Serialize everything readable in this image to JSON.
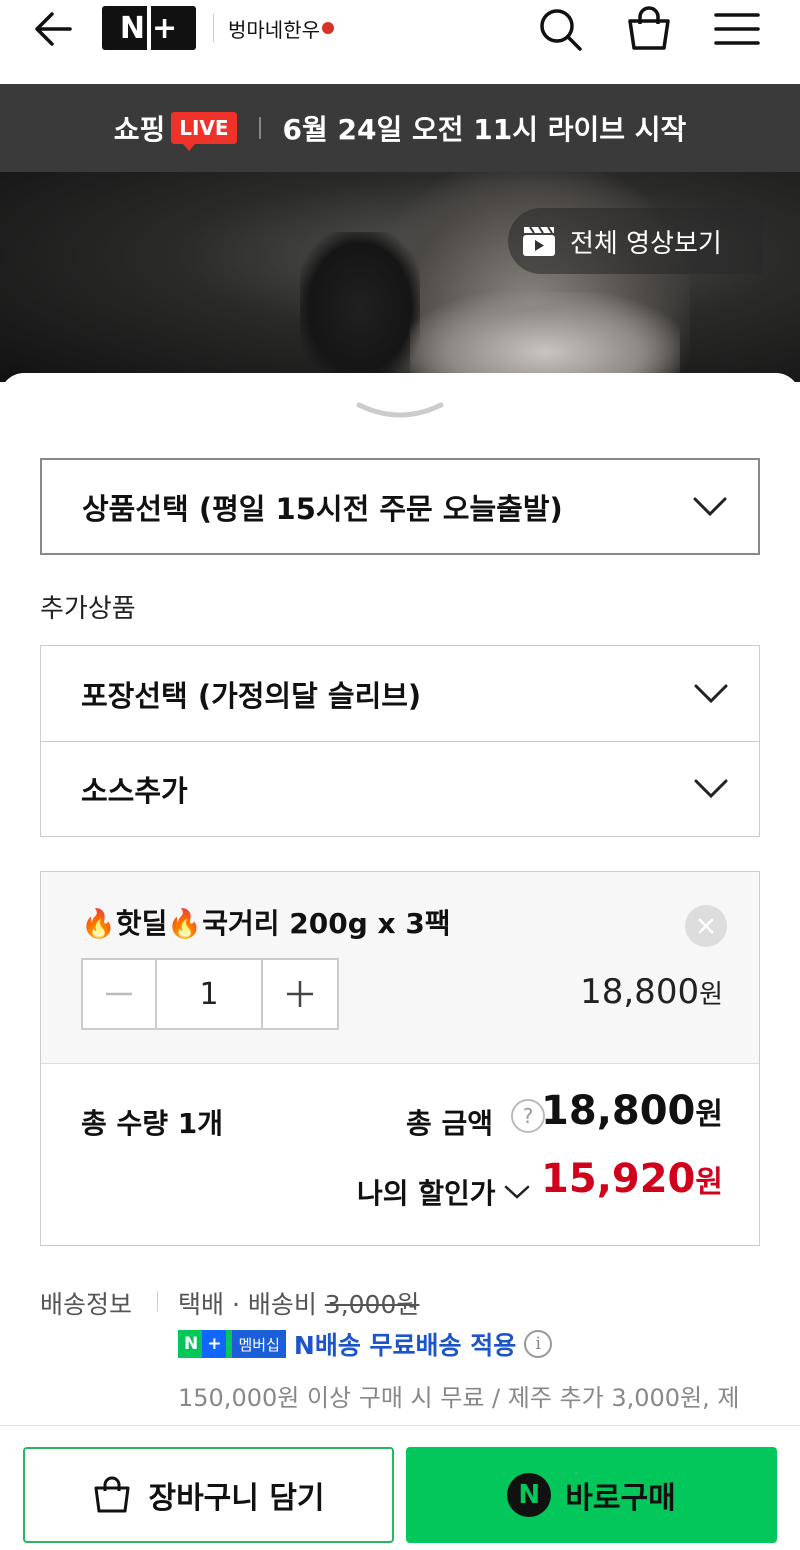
{
  "header": {
    "logo_text_n": "N",
    "logo_text_plus": "+",
    "brand_text": "벙마네한우",
    "icons": [
      "back-arrow-icon",
      "search-icon",
      "shopping-bag-icon",
      "menu-icon"
    ]
  },
  "live_banner": {
    "shopping": "쇼핑",
    "badge": "LIVE",
    "text": "6월 24일 오전 11시 라이브 시작"
  },
  "video": {
    "full_video_label": "전체 영상보기"
  },
  "options": {
    "main_select": "상품선택 (평일 15시전 주문 오늘출발)",
    "addon_title": "추가상품",
    "addons": [
      {
        "label": "포장선택 (가정의달 슬리브)"
      },
      {
        "label": "소스추가"
      }
    ]
  },
  "selected_item": {
    "name": "🔥핫딜🔥국거리 200g x 3팩",
    "quantity": "1",
    "price": "18,800",
    "currency": "원"
  },
  "totals": {
    "qty_label": "총 수량 1개",
    "amount_label": "총 금액",
    "help": "?",
    "amount": "18,800",
    "currency": "원",
    "discount_label": "나의 할인가",
    "discount_amount": "15,920",
    "discount_currency": "원"
  },
  "shipping": {
    "label": "배송정보",
    "method": "택배 · 배송비 ",
    "fee": "3,000원",
    "n_badge": "N",
    "plus_badge": "+",
    "member_badge": "멤버십",
    "n_delivery": "N배송 무료배송 적용",
    "info": "i",
    "condition": "150,000원 이상 구매 시 무료 / 제주 추가 3,000원, 제"
  },
  "actions": {
    "cart": "장바구니 담기",
    "buy_icon": "N",
    "buy": "바로구매"
  },
  "colors": {
    "brand_green": "#03c75a",
    "discount_red": "#d0021b",
    "live_red": "#f0332a",
    "n_delivery_blue": "#1b55c9"
  }
}
